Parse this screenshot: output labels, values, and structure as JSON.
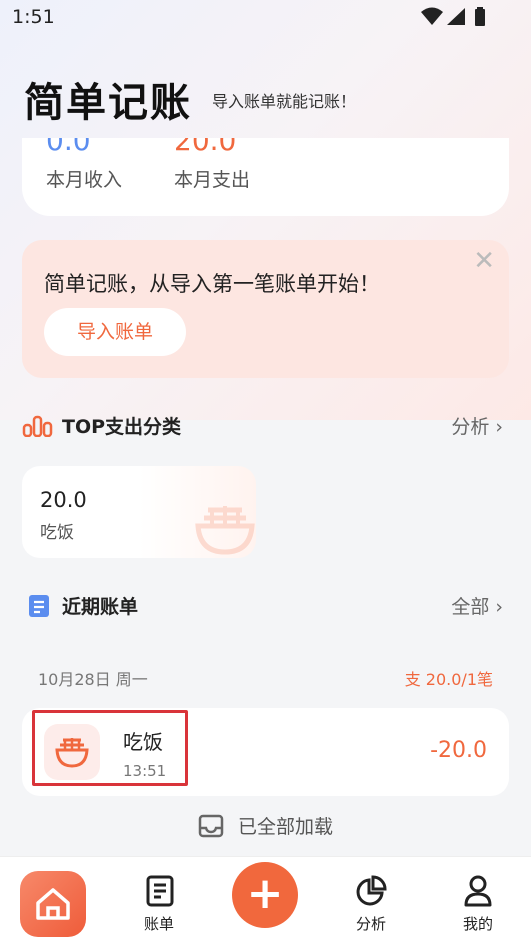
{
  "status_bar": {
    "time": "1:51"
  },
  "header": {
    "title": "简单记账",
    "subtitle": "导入账单就能记账！"
  },
  "summary": {
    "income_value": "0.0",
    "income_label": "本月收入",
    "expense_value": "20.0",
    "expense_label": "本月支出"
  },
  "import_card": {
    "text": "简单记账，从导入第一笔账单开始！",
    "button": "导入账单"
  },
  "top_expense": {
    "title": "TOP支出分类",
    "link": "分析",
    "items": [
      {
        "value": "20.0",
        "label": "吃饭"
      }
    ]
  },
  "recent": {
    "title": "近期账单",
    "link": "全部",
    "date": "10月28日 周一",
    "summary_prefix": "支",
    "summary_value": "20.0/1笔",
    "bills": [
      {
        "name": "吃饭",
        "time": "13:51",
        "amount": "-20.0"
      }
    ]
  },
  "loaded_text": "已全部加载",
  "tabbar": {
    "bills": "账单",
    "analysis": "分析",
    "mine": "我的"
  },
  "colors": {
    "accent": "#f0683e",
    "income": "#5b8def",
    "highlight": "#d9343a"
  }
}
